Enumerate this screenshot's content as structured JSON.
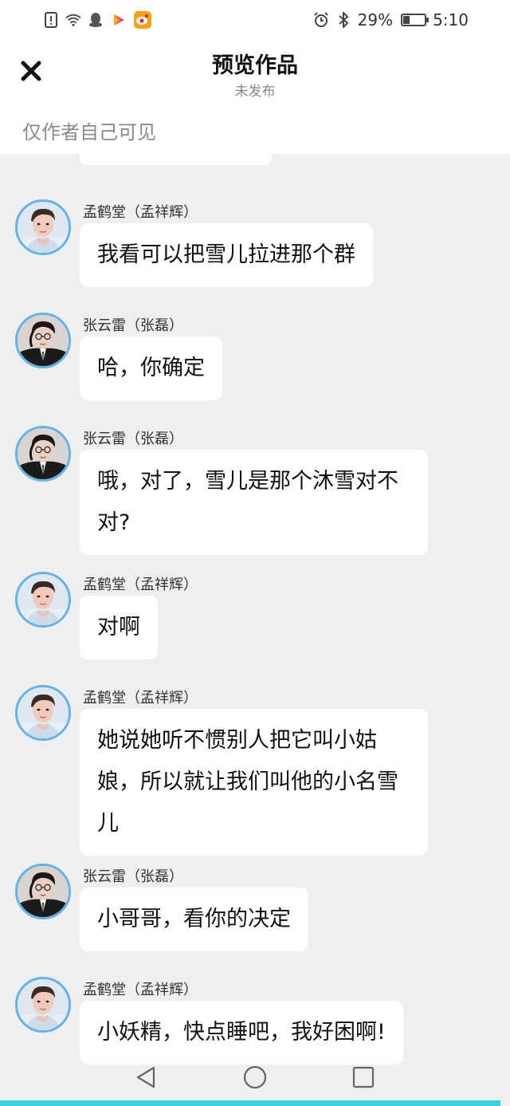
{
  "status_bar": {
    "battery_percent": "29%",
    "battery_level": 0.29,
    "time": "5:10",
    "icons_left": [
      "alert-icon",
      "wifi-icon",
      "qq-icon",
      "video-app-icon",
      "weibo-icon"
    ],
    "icons_right": [
      "alarm-icon",
      "bluetooth-icon",
      "battery-icon"
    ]
  },
  "header": {
    "title": "预览作品",
    "subtitle": "未发布",
    "visibility_note": "仅作者自己可见"
  },
  "chars": {
    "meng": {
      "name": "孟鹤堂（孟祥辉）",
      "avatar": "avatar-meng"
    },
    "zhang": {
      "name": "张云雷（张磊）",
      "avatar": "avatar-zhang"
    }
  },
  "messages": [
    {
      "sender": "孟鹤堂（孟祥辉）",
      "char": "meng",
      "text": "我看可以把雪儿拉进那个群"
    },
    {
      "sender": "张云雷（张磊）",
      "char": "zhang",
      "text": "哈，你确定"
    },
    {
      "sender": "张云雷（张磊）",
      "char": "zhang",
      "text": "哦，对了，雪儿是那个沐雪对不对?"
    },
    {
      "sender": "孟鹤堂（孟祥辉）",
      "char": "meng",
      "text": "对啊"
    },
    {
      "sender": "孟鹤堂（孟祥辉）",
      "char": "meng",
      "text": "她说她听不惯别人把它叫小姑娘，所以就让我们叫他的小名雪儿"
    },
    {
      "sender": "张云雷（张磊）",
      "char": "zhang",
      "text": "小哥哥，看你的决定"
    },
    {
      "sender": "孟鹤堂（孟祥辉）",
      "char": "meng",
      "text": "小妖精，快点睡吧，我好困啊!"
    }
  ],
  "colors": {
    "avatar_ring": "#62b3e8",
    "accent_bottom": "#3bd1dd",
    "chat_bg": "#efeff0"
  },
  "nav": {
    "back": "back-triangle-icon",
    "home": "home-circle-icon",
    "recent": "recent-square-icon"
  }
}
